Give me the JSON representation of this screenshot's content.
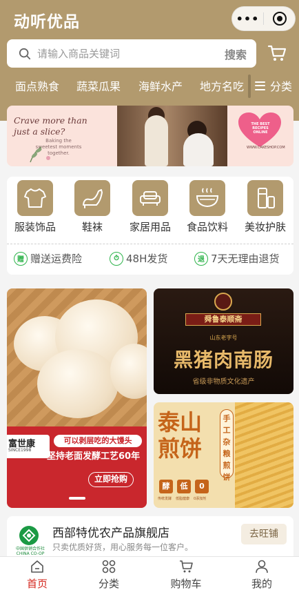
{
  "header": {
    "app_title": "动听优品",
    "capsule": {
      "more_icon": "more-dots-icon",
      "close_icon": "target-close-icon"
    },
    "search": {
      "placeholder": "请输入商品关键词",
      "button": "搜索"
    },
    "cart_icon": "cart-icon",
    "categories": [
      "面点熟食",
      "蔬菜瓜果",
      "海鲜水产",
      "地方名吃"
    ],
    "all_categories": "分类",
    "bg_color": "#b29a6e"
  },
  "banner": {
    "headline": "Crave more than just a slice?",
    "subline": "Baking the sweetest moments together.",
    "badge": "THE BEST RECIPES ONLINE",
    "url": "WWW.CAKESHOP.COM"
  },
  "quick_links": [
    {
      "label": "服装饰品",
      "icon": "tshirt-icon"
    },
    {
      "label": "鞋袜",
      "icon": "high-heel-icon"
    },
    {
      "label": "家居用品",
      "icon": "sofa-icon"
    },
    {
      "label": "食品饮料",
      "icon": "bowl-icon"
    },
    {
      "label": "美妆护肤",
      "icon": "cosmetics-icon"
    }
  ],
  "guarantees": [
    {
      "label": "赠送运费险",
      "glyph": "赠",
      "icon": "insurance-icon"
    },
    {
      "label": "48H发货",
      "glyph": "⏱",
      "icon": "clock-icon"
    },
    {
      "label": "7天无理由退货",
      "glyph": "退",
      "icon": "return-icon"
    }
  ],
  "promo_left": {
    "brand": "富世康",
    "since": "SINCE1998",
    "slogan1": "可以剥层吃的大馒头",
    "slogan2": "坚持老面发酵工艺60年",
    "button": "立即抢购"
  },
  "promo_right_top": {
    "brand": "舜鲁泰顺斋",
    "subtitle": "山东老字号",
    "title": "黑猪肉南肠",
    "footer": "省级非物质文化遗产"
  },
  "promo_right_bottom": {
    "title": "泰山煎饼",
    "vertical": "手工杂粮煎饼",
    "badges": [
      "酵",
      "低",
      "0"
    ],
    "captions": [
      "传统发酵",
      "低脂健康",
      "0添加剂"
    ]
  },
  "store": {
    "name": "西部特优农产品旗舰店",
    "desc": "只卖优质好货，用心服务每一位客户。",
    "logo_text": "中国供销合作社 CHINA CO-OP",
    "button": "去旺铺"
  },
  "tabbar": [
    {
      "label": "首页",
      "icon": "home-icon",
      "active": true
    },
    {
      "label": "分类",
      "icon": "grid-icon",
      "active": false
    },
    {
      "label": "购物车",
      "icon": "cart-icon",
      "active": false
    },
    {
      "label": "我的",
      "icon": "user-icon",
      "active": false
    }
  ],
  "accent_color": "#d4271e"
}
